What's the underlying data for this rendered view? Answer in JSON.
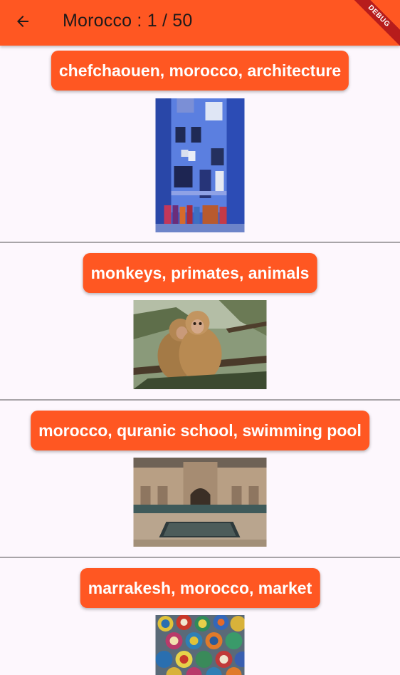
{
  "appbar": {
    "title": "Morocco : 1 / 50",
    "back_icon": "arrow-left-icon",
    "background": "#ff5722",
    "debug_banner": "DEBUG"
  },
  "items": [
    {
      "caption": "chefchaouen, morocco, architecture",
      "image": "chefchaouen-blue-street"
    },
    {
      "caption": "monkeys, primates, animals",
      "image": "monkeys-in-tree"
    },
    {
      "caption": "morocco, quranic school, swimming pool",
      "image": "medersa-courtyard-pool"
    },
    {
      "caption": "marrakesh, morocco, market",
      "image": "ceramic-bowls-market"
    }
  ],
  "colors": {
    "accent": "#ff5722",
    "background": "#fdf7fd",
    "divider": "#a8a4a8"
  }
}
